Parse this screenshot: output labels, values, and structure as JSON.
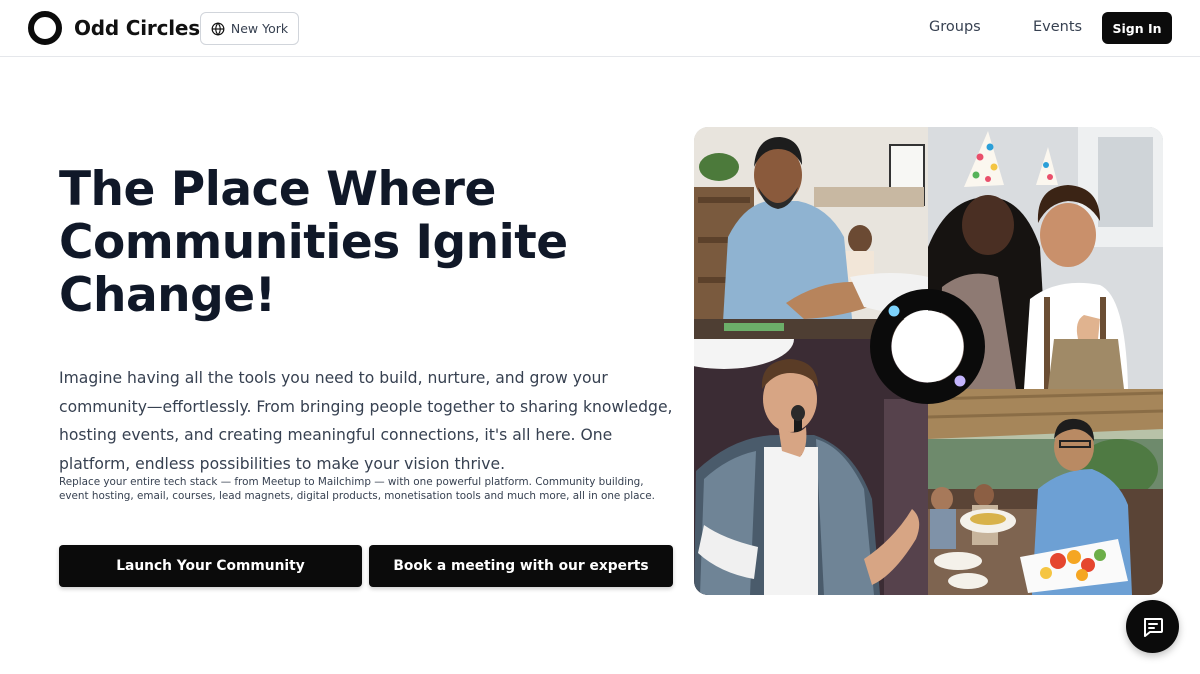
{
  "header": {
    "brand_name": "Odd Circles",
    "location_label": "New York",
    "nav": {
      "groups": "Groups",
      "events": "Events"
    },
    "sign_in": "Sign In"
  },
  "hero": {
    "title": "The Place Where Communities Ignite Change!",
    "body": "Imagine having all the tools you need to build, nurture, and grow your community—effortlessly. From bringing people together to sharing knowledge, hosting events, and creating meaningful connections, it's all here. One platform, endless possibilities to make your vision thrive.",
    "small_print": "Replace your entire tech stack — from Meetup to Mailchimp — with one powerful platform. Community building, event hosting, email, courses, lead magnets, digital products, monetisation tools and much more, all in one place.",
    "cta_primary": "Launch Your Community",
    "cta_secondary": "Book a meeting with our experts"
  },
  "collage": {
    "photos": [
      "handshake-photo",
      "party-hats-photo",
      "speaker-photo",
      "outdoor-dinner-photo"
    ]
  },
  "colors": {
    "primary": "#0b0b0b",
    "text": "#101828",
    "muted": "#374151",
    "ring_dot_blue": "#7dd3fc",
    "ring_dot_purple": "#c4b5fd"
  },
  "icons": {
    "logo": "odd-circles-logo-icon",
    "location": "globe-icon",
    "chat": "chat-bubble-icon"
  }
}
